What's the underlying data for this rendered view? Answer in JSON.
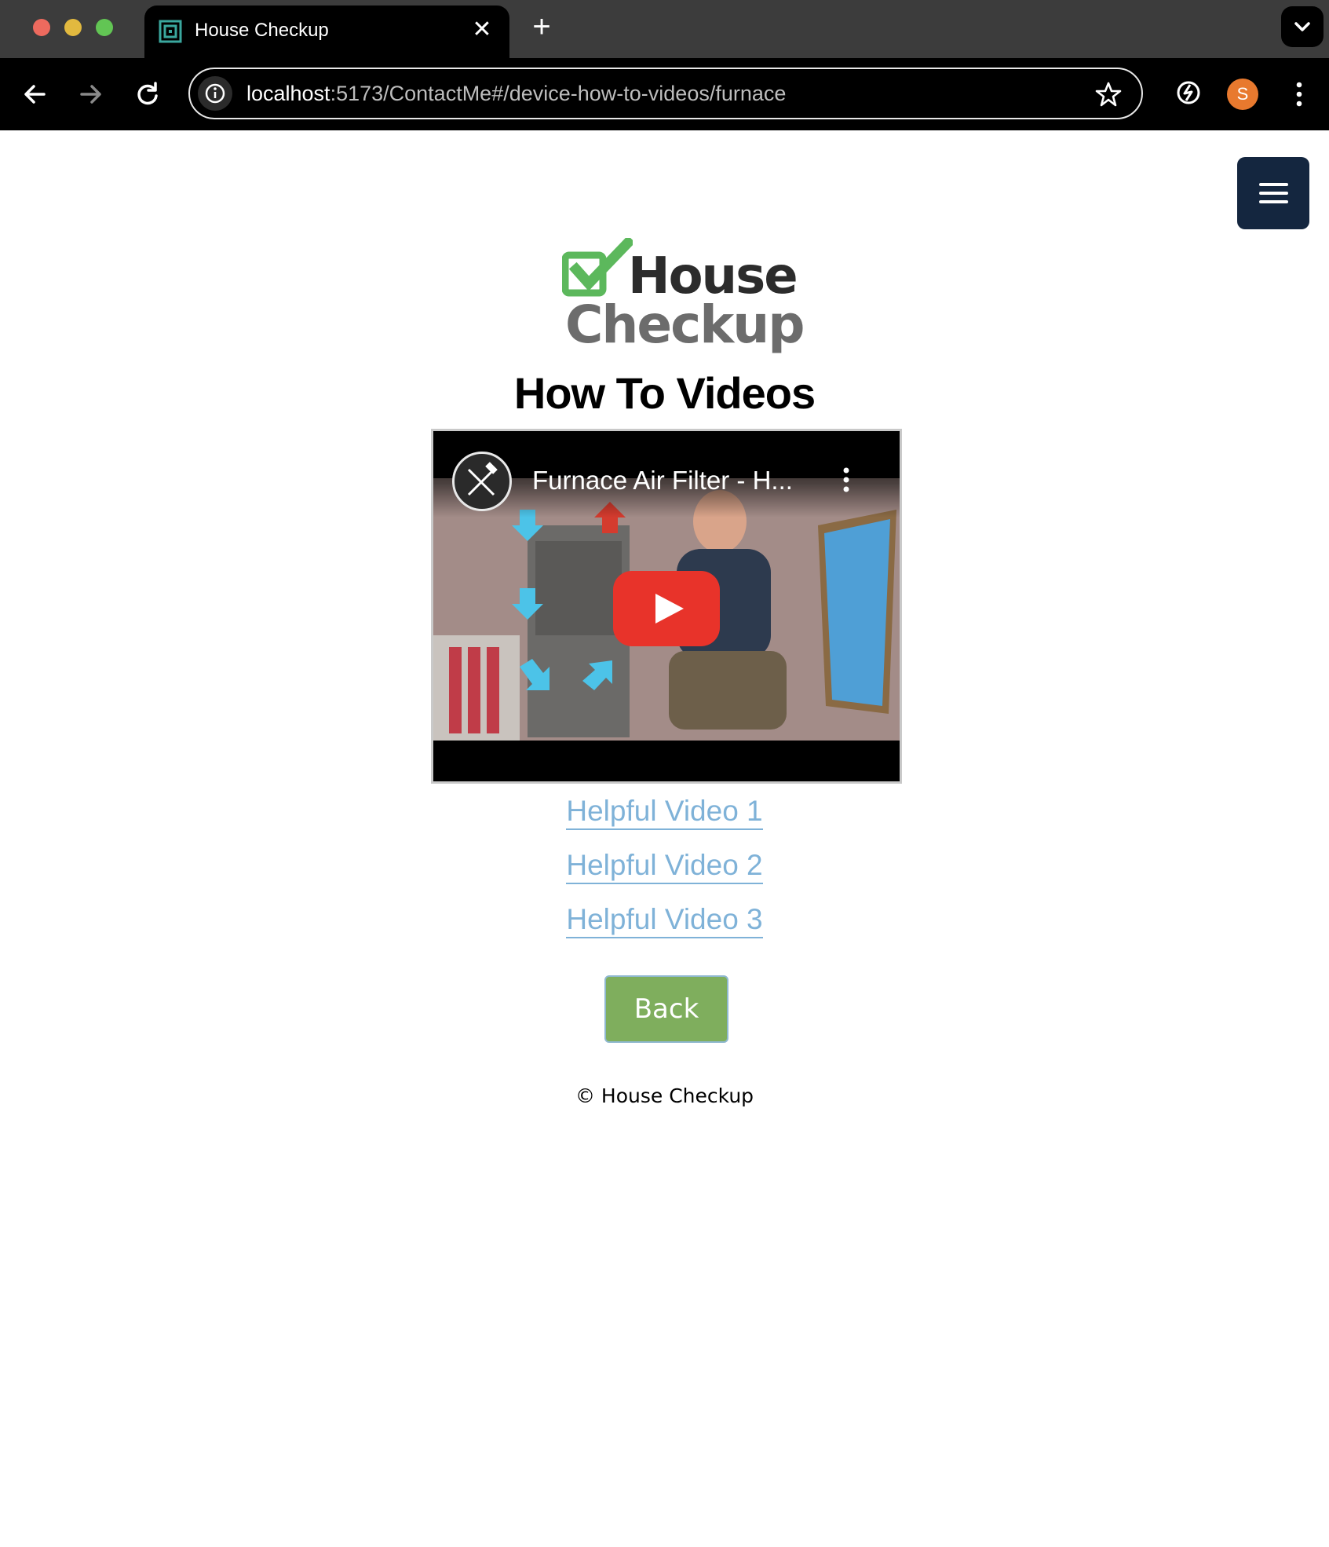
{
  "browser": {
    "tab_title": "House Checkup",
    "tab_close_icon": "close-icon",
    "new_tab_symbol": "+",
    "url_host": "localhost",
    "url_rest": ":5173/ContactMe#/device-how-to-videos/furnace",
    "profile_initial": "S",
    "profile_color": "#e8792e"
  },
  "page": {
    "logo_line1": "House",
    "logo_line2": "Checkup",
    "title": "How To Videos",
    "video": {
      "title": "Furnace Air Filter - H..."
    },
    "links": [
      "Helpful Video 1",
      "Helpful Video 2",
      "Helpful Video 3"
    ],
    "back_label": "Back",
    "footer": "© House Checkup"
  },
  "colors": {
    "link": "#7fb2d8",
    "back_button": "#7fae5d",
    "menu_button": "#14263f",
    "logo_green": "#5cb85c"
  }
}
